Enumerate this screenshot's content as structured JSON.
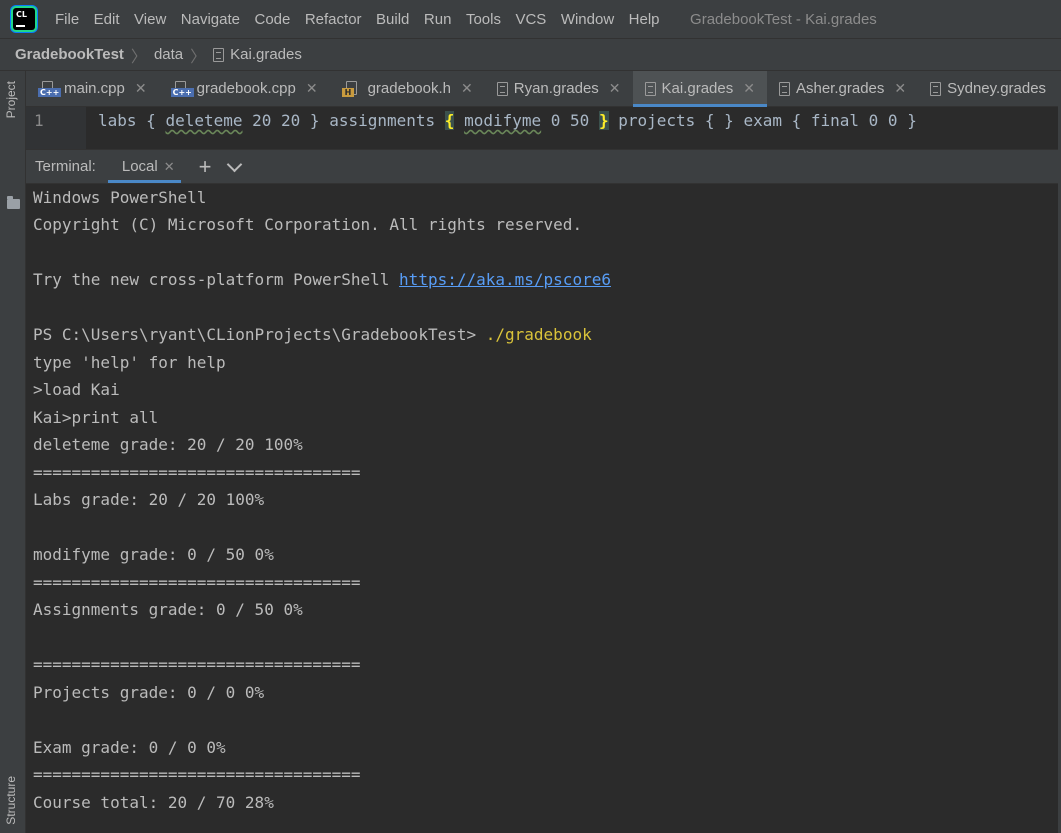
{
  "menu": {
    "items": [
      "File",
      "Edit",
      "View",
      "Navigate",
      "Code",
      "Refactor",
      "Build",
      "Run",
      "Tools",
      "VCS",
      "Window",
      "Help"
    ],
    "window_title": "GradebookTest - Kai.grades"
  },
  "app_logo_text": "CL",
  "breadcrumb": {
    "project": "GradebookTest",
    "folder": "data",
    "file": "Kai.grades"
  },
  "left_strip": {
    "project": "Project",
    "structure": "Structure"
  },
  "tabs": [
    {
      "label": "main.cpp",
      "icon": "cpp-file-icon",
      "active": false
    },
    {
      "label": "gradebook.cpp",
      "icon": "cpp-file-icon",
      "active": false
    },
    {
      "label": "gradebook.h",
      "icon": "header-file-icon",
      "active": false
    },
    {
      "label": "Ryan.grades",
      "icon": "text-file-icon",
      "active": false
    },
    {
      "label": "Kai.grades",
      "icon": "text-file-icon",
      "active": true
    },
    {
      "label": "Asher.grades",
      "icon": "text-file-icon",
      "active": false
    },
    {
      "label": "Sydney.grades",
      "icon": "text-file-icon",
      "active": false
    }
  ],
  "editor": {
    "line_number": "1",
    "seg1": "labs { ",
    "seg2": "deleteme",
    "seg3": " 20 20 } assignments ",
    "brace_open": "{",
    "seg4": " ",
    "seg5": "modifyme",
    "seg6": " 0 50 ",
    "brace_close": "}",
    "seg7": " projects { } exam { final 0 0 }"
  },
  "terminal": {
    "title": "Terminal:",
    "tab": "Local",
    "add": "+",
    "lines": {
      "l1": "Windows PowerShell",
      "l2": "Copyright (C) Microsoft Corporation. All rights reserved.",
      "l3_text": "Try the new cross-platform PowerShell ",
      "l3_link": "https://aka.ms/pscore6",
      "l4_prompt": "PS C:\\Users\\ryant\\CLionProjects\\GradebookTest> ",
      "l4_cmd": "./gradebook",
      "l5": "type 'help' for help",
      "l6": ">load Kai",
      "l7": "Kai>print all",
      "l8": "deleteme grade: 20 / 20 100%",
      "l9": "==================================",
      "l10": "Labs grade: 20 / 20 100%",
      "l11": "modifyme grade: 0 / 50 0%",
      "l12": "==================================",
      "l13": "Assignments grade: 0 / 50 0%",
      "l14": "==================================",
      "l15": "Projects grade: 0 / 0 0%",
      "l16": "Exam grade: 0 / 0 0%",
      "l17": "==================================",
      "l18": "Course total: 20 / 70 28%"
    }
  }
}
